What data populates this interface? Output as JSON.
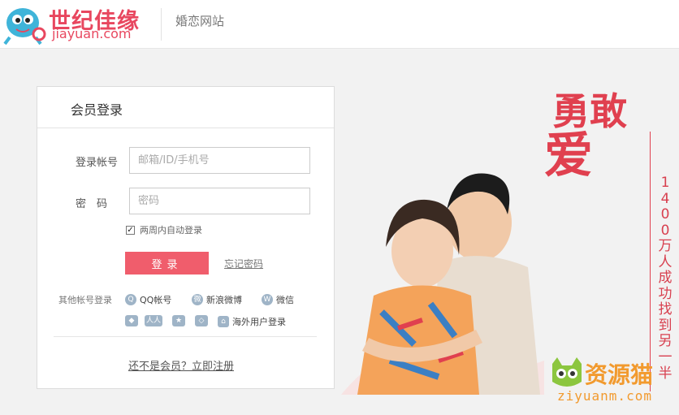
{
  "header": {
    "logo_cn": "世纪佳缘",
    "logo_en": "jiayuan.com",
    "site_type": "婚恋网站"
  },
  "login": {
    "title": "会员登录",
    "account_label": "登录帐号",
    "account_placeholder": "邮箱/ID/手机号",
    "password_label": "密　码",
    "password_placeholder": "密码",
    "remember_label": "两周内自动登录",
    "remember_checked": true,
    "submit_label": "登录",
    "forgot_label": "忘记密码",
    "other_accounts_label": "其他帐号登录",
    "social": {
      "qq": "QQ帐号",
      "weibo": "新浪微博",
      "wechat": "微信",
      "overseas": "海外用户登录"
    },
    "register_label": "还不是会员？立即注册"
  },
  "promo": {
    "slogan_line1": "勇敢",
    "slogan_line2": "爱",
    "vertical_text": "1400万人成功找到另一半"
  },
  "watermark": {
    "cn": "资源猫",
    "en": "ziyuanm.com"
  },
  "colors": {
    "brand": "#e8475f",
    "button": "#f05d6c",
    "background": "#f2f2f2"
  }
}
